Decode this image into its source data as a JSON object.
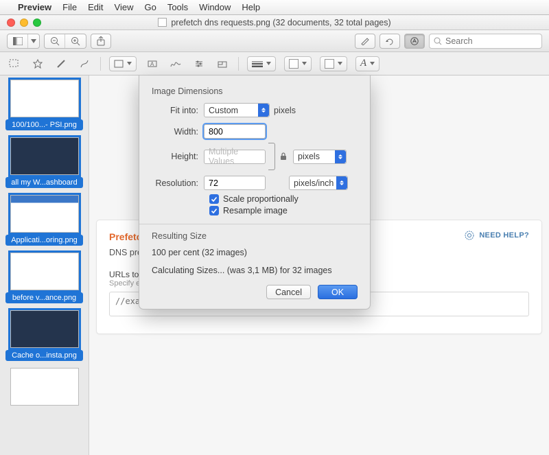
{
  "menubar": {
    "app": "Preview",
    "items": [
      "File",
      "Edit",
      "View",
      "Go",
      "Tools",
      "Window",
      "Help"
    ]
  },
  "window": {
    "title": "prefetch dns requests.png (32 documents, 32 total pages)",
    "search_placeholder": "Search"
  },
  "sidebar": {
    "thumbs": [
      {
        "label": "100/100...- PSI.png",
        "selected": true
      },
      {
        "label": "all my W...ashboard",
        "selected": true
      },
      {
        "label": "Applicati...oring.png",
        "selected": true
      },
      {
        "label": "before v...ance.png",
        "selected": true
      },
      {
        "label": "Cache o...insta.png",
        "selected": true
      },
      {
        "label": "",
        "selected": false
      }
    ]
  },
  "dialog": {
    "section1_title": "Image Dimensions",
    "fit_into_label": "Fit into:",
    "fit_into_value": "Custom",
    "fit_into_unit": "pixels",
    "width_label": "Width:",
    "width_value": "800",
    "height_label": "Height:",
    "height_value": "Multiple Values",
    "wh_unit": "pixels",
    "resolution_label": "Resolution:",
    "resolution_value": "72",
    "resolution_unit": "pixels/inch",
    "scale_label": "Scale proportionally",
    "resample_label": "Resample image",
    "section2_title": "Resulting Size",
    "result_line1": "100 per cent (32 images)",
    "result_line2": "Calculating Sizes... (was 3,1 MB) for 32 images",
    "cancel": "Cancel",
    "ok": "OK"
  },
  "document": {
    "heading": "Prefetch DNS Re",
    "sub": "DNS prefetching ca",
    "help": "NEED HELP?",
    "field_label": "URLs to prefetc",
    "field_hint": "Specify external h",
    "textarea_value": "//example.com"
  }
}
